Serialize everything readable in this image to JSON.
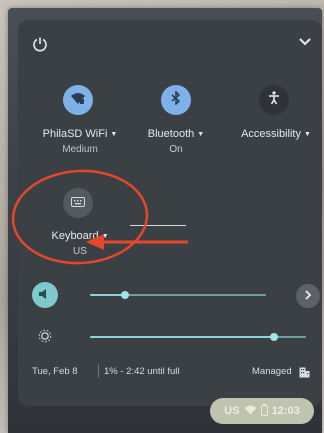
{
  "header": {
    "power_icon": "power-icon",
    "collapse_icon": "chevron-down-icon"
  },
  "tiles": [
    {
      "id": "wifi",
      "label": "PhilaSD WiFi",
      "sub": "Medium",
      "icon": "wifi-icon",
      "active": true
    },
    {
      "id": "bluetooth",
      "label": "Bluetooth",
      "sub": "On",
      "icon": "bluetooth-icon",
      "active": true
    },
    {
      "id": "accessibility",
      "label": "Accessibility",
      "sub": "",
      "icon": "accessibility-icon",
      "active": false
    },
    {
      "id": "keyboard",
      "label": "Keyboard",
      "sub": "US",
      "icon": "keyboard-icon",
      "active": false
    }
  ],
  "sliders": {
    "volume": {
      "icon": "volume-icon",
      "level": 0.2,
      "more_icon": "chevron-right-icon"
    },
    "brightness": {
      "icon": "brightness-icon",
      "level": 0.85
    }
  },
  "status": {
    "date": "Tue, Feb 8",
    "battery": "1% - 2:42 until full",
    "managed": "Managed",
    "managed_icon": "building-icon"
  },
  "shelf": {
    "lang": "US",
    "time": "12:03",
    "wifi_icon": "wifi-icon",
    "battery_icon": "battery-icon"
  },
  "colors": {
    "accent": "#8ab4f8",
    "panel": "#3b4045",
    "annotation": "#e8452d"
  }
}
